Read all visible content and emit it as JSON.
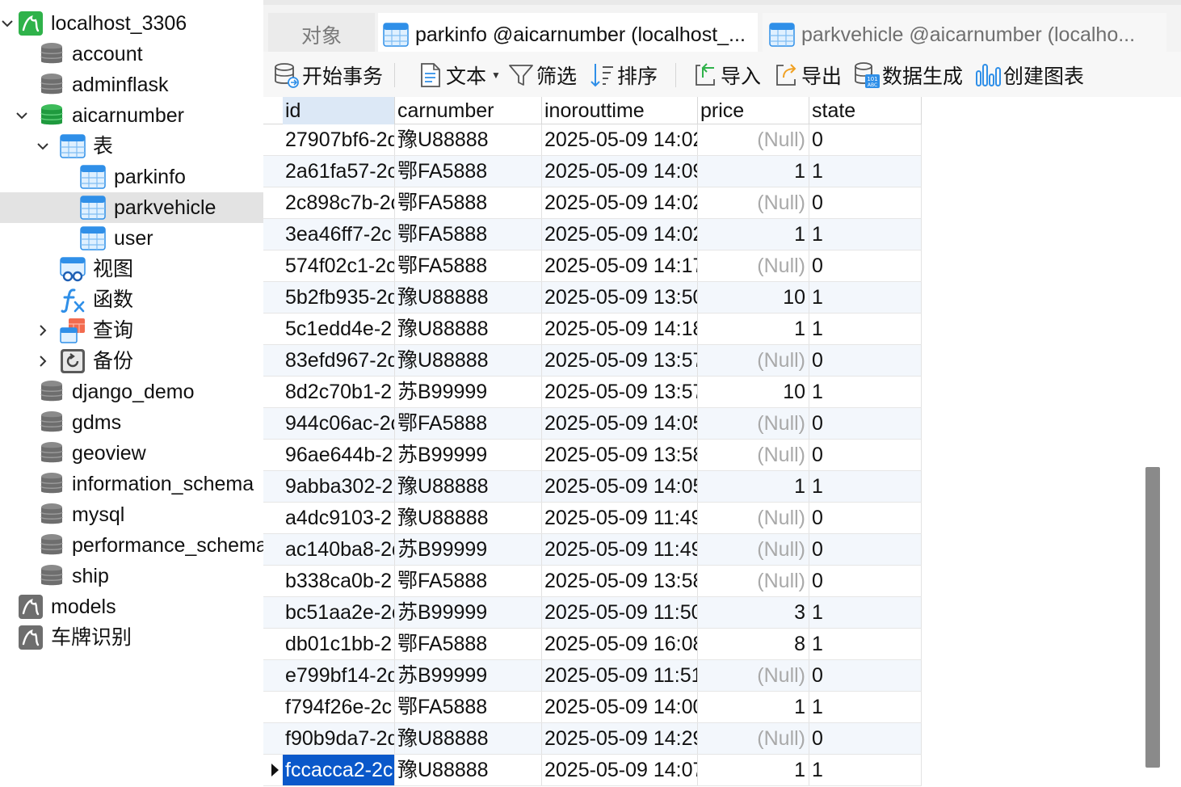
{
  "sidebar": {
    "connection": {
      "label": "localhost_3306",
      "icon": "connection-icon"
    },
    "databases": [
      {
        "label": "account"
      },
      {
        "label": "adminflask"
      },
      {
        "label": "aicarnumber"
      }
    ],
    "aicarnumber": {
      "tables_group": {
        "label": "表"
      },
      "tables": [
        {
          "label": "parkinfo"
        },
        {
          "label": "parkvehicle",
          "selected": true
        },
        {
          "label": "user"
        }
      ],
      "views": {
        "label": "视图"
      },
      "functions": {
        "label": "函数"
      },
      "queries": {
        "label": "查询"
      },
      "backups": {
        "label": "备份"
      }
    },
    "more_databases": [
      {
        "label": "django_demo"
      },
      {
        "label": "gdms"
      },
      {
        "label": "geoview"
      },
      {
        "label": "information_schema"
      },
      {
        "label": "mysql"
      },
      {
        "label": "performance_schema"
      },
      {
        "label": "ship"
      }
    ],
    "other_connections": [
      {
        "label": "models"
      },
      {
        "label": "车牌识别"
      }
    ]
  },
  "tabs": [
    {
      "label": "对象"
    },
    {
      "label": "parkinfo @aicarnumber (localhost_..."
    },
    {
      "label": "parkvehicle @aicarnumber (localho..."
    }
  ],
  "toolbar": {
    "begin_transaction": "开始事务",
    "text": "文本",
    "filter": "筛选",
    "sort": "排序",
    "import": "导入",
    "export": "导出",
    "data_generation": "数据生成",
    "create_chart": "创建图表"
  },
  "grid": {
    "columns": [
      "id",
      "carnumber",
      "inorouttime",
      "price",
      "state"
    ],
    "null_text": "(Null)",
    "rows": [
      {
        "id": "27907bf6-2d",
        "carnumber": "豫U88888",
        "inorouttime": "2025-05-09 14:02",
        "price": null,
        "state": "0"
      },
      {
        "id": "2a61fa57-2c",
        "carnumber": "鄂FA5888",
        "inorouttime": "2025-05-09 14:09",
        "price": "1",
        "state": "1"
      },
      {
        "id": "2c898c7b-2d",
        "carnumber": "鄂FA5888",
        "inorouttime": "2025-05-09 14:02",
        "price": null,
        "state": "0"
      },
      {
        "id": "3ea46ff7-2c",
        "carnumber": "鄂FA5888",
        "inorouttime": "2025-05-09 14:02",
        "price": "1",
        "state": "1"
      },
      {
        "id": "574f02c1-2c",
        "carnumber": "鄂FA5888",
        "inorouttime": "2025-05-09 14:17",
        "price": null,
        "state": "0"
      },
      {
        "id": "5b2fb935-2d",
        "carnumber": "豫U88888",
        "inorouttime": "2025-05-09 13:50",
        "price": "10",
        "state": "1"
      },
      {
        "id": "5c1edd4e-2",
        "carnumber": "豫U88888",
        "inorouttime": "2025-05-09 14:18",
        "price": "1",
        "state": "1"
      },
      {
        "id": "83efd967-2d",
        "carnumber": "豫U88888",
        "inorouttime": "2025-05-09 13:57",
        "price": null,
        "state": "0"
      },
      {
        "id": "8d2c70b1-2",
        "carnumber": "苏B99999",
        "inorouttime": "2025-05-09 13:57",
        "price": "10",
        "state": "1"
      },
      {
        "id": "944c06ac-2d",
        "carnumber": "鄂FA5888",
        "inorouttime": "2025-05-09 14:05",
        "price": null,
        "state": "0"
      },
      {
        "id": "96ae644b-2",
        "carnumber": "苏B99999",
        "inorouttime": "2025-05-09 13:58",
        "price": null,
        "state": "0"
      },
      {
        "id": "9abba302-2",
        "carnumber": "豫U88888",
        "inorouttime": "2025-05-09 14:05",
        "price": "1",
        "state": "1"
      },
      {
        "id": "a4dc9103-2",
        "carnumber": "豫U88888",
        "inorouttime": "2025-05-09 11:49",
        "price": null,
        "state": "0"
      },
      {
        "id": "ac140ba8-2d",
        "carnumber": "苏B99999",
        "inorouttime": "2025-05-09 11:49",
        "price": null,
        "state": "0"
      },
      {
        "id": "b338ca0b-2",
        "carnumber": "鄂FA5888",
        "inorouttime": "2025-05-09 13:58",
        "price": null,
        "state": "0"
      },
      {
        "id": "bc51aa2e-2d",
        "carnumber": "苏B99999",
        "inorouttime": "2025-05-09 11:50",
        "price": "3",
        "state": "1"
      },
      {
        "id": "db01c1bb-2",
        "carnumber": "鄂FA5888",
        "inorouttime": "2025-05-09 16:08",
        "price": "8",
        "state": "1"
      },
      {
        "id": "e799bf14-2d",
        "carnumber": "苏B99999",
        "inorouttime": "2025-05-09 11:51",
        "price": null,
        "state": "0"
      },
      {
        "id": "f794f26e-2c",
        "carnumber": "鄂FA5888",
        "inorouttime": "2025-05-09 14:00",
        "price": "1",
        "state": "1"
      },
      {
        "id": "f90b9da7-2d",
        "carnumber": "豫U88888",
        "inorouttime": "2025-05-09 14:29",
        "price": null,
        "state": "0"
      },
      {
        "id": "fccacca2-2c1",
        "carnumber": "豫U88888",
        "inorouttime": "2025-05-09 14:07",
        "price": "1",
        "state": "1",
        "current": true
      }
    ]
  },
  "colors": {
    "selection": "#0a58ca",
    "alt_row": "#f3f7fc",
    "null_text": "#a9a9a9",
    "active_header": "#dce8f6",
    "sidebar_selected": "#e3e3e3",
    "connection_green": "#2fb24a",
    "db_gray": "#6e6e6e",
    "db_green": "#1f9a3e",
    "table_blue": "#2f8fe8"
  }
}
